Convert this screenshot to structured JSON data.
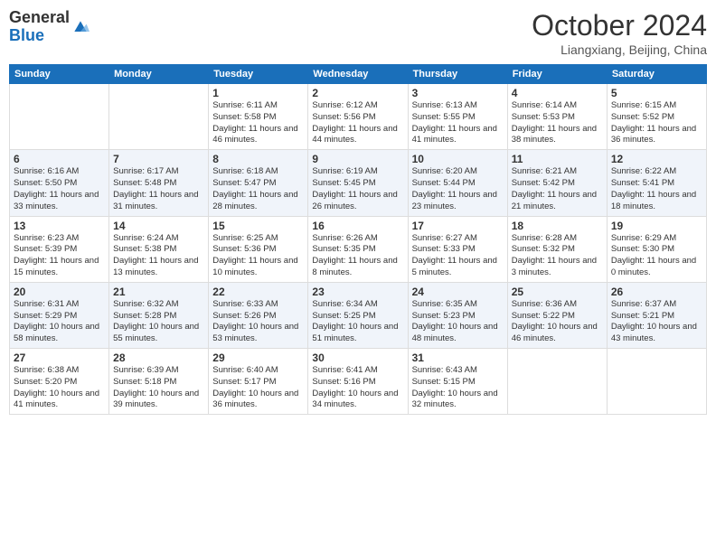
{
  "logo": {
    "line1": "General",
    "line2": "Blue"
  },
  "title": "October 2024",
  "location": "Liangxiang, Beijing, China",
  "headers": [
    "Sunday",
    "Monday",
    "Tuesday",
    "Wednesday",
    "Thursday",
    "Friday",
    "Saturday"
  ],
  "weeks": [
    [
      {
        "day": "",
        "info": ""
      },
      {
        "day": "",
        "info": ""
      },
      {
        "day": "1",
        "info": "Sunrise: 6:11 AM\nSunset: 5:58 PM\nDaylight: 11 hours and 46 minutes."
      },
      {
        "day": "2",
        "info": "Sunrise: 6:12 AM\nSunset: 5:56 PM\nDaylight: 11 hours and 44 minutes."
      },
      {
        "day": "3",
        "info": "Sunrise: 6:13 AM\nSunset: 5:55 PM\nDaylight: 11 hours and 41 minutes."
      },
      {
        "day": "4",
        "info": "Sunrise: 6:14 AM\nSunset: 5:53 PM\nDaylight: 11 hours and 38 minutes."
      },
      {
        "day": "5",
        "info": "Sunrise: 6:15 AM\nSunset: 5:52 PM\nDaylight: 11 hours and 36 minutes."
      }
    ],
    [
      {
        "day": "6",
        "info": "Sunrise: 6:16 AM\nSunset: 5:50 PM\nDaylight: 11 hours and 33 minutes."
      },
      {
        "day": "7",
        "info": "Sunrise: 6:17 AM\nSunset: 5:48 PM\nDaylight: 11 hours and 31 minutes."
      },
      {
        "day": "8",
        "info": "Sunrise: 6:18 AM\nSunset: 5:47 PM\nDaylight: 11 hours and 28 minutes."
      },
      {
        "day": "9",
        "info": "Sunrise: 6:19 AM\nSunset: 5:45 PM\nDaylight: 11 hours and 26 minutes."
      },
      {
        "day": "10",
        "info": "Sunrise: 6:20 AM\nSunset: 5:44 PM\nDaylight: 11 hours and 23 minutes."
      },
      {
        "day": "11",
        "info": "Sunrise: 6:21 AM\nSunset: 5:42 PM\nDaylight: 11 hours and 21 minutes."
      },
      {
        "day": "12",
        "info": "Sunrise: 6:22 AM\nSunset: 5:41 PM\nDaylight: 11 hours and 18 minutes."
      }
    ],
    [
      {
        "day": "13",
        "info": "Sunrise: 6:23 AM\nSunset: 5:39 PM\nDaylight: 11 hours and 15 minutes."
      },
      {
        "day": "14",
        "info": "Sunrise: 6:24 AM\nSunset: 5:38 PM\nDaylight: 11 hours and 13 minutes."
      },
      {
        "day": "15",
        "info": "Sunrise: 6:25 AM\nSunset: 5:36 PM\nDaylight: 11 hours and 10 minutes."
      },
      {
        "day": "16",
        "info": "Sunrise: 6:26 AM\nSunset: 5:35 PM\nDaylight: 11 hours and 8 minutes."
      },
      {
        "day": "17",
        "info": "Sunrise: 6:27 AM\nSunset: 5:33 PM\nDaylight: 11 hours and 5 minutes."
      },
      {
        "day": "18",
        "info": "Sunrise: 6:28 AM\nSunset: 5:32 PM\nDaylight: 11 hours and 3 minutes."
      },
      {
        "day": "19",
        "info": "Sunrise: 6:29 AM\nSunset: 5:30 PM\nDaylight: 11 hours and 0 minutes."
      }
    ],
    [
      {
        "day": "20",
        "info": "Sunrise: 6:31 AM\nSunset: 5:29 PM\nDaylight: 10 hours and 58 minutes."
      },
      {
        "day": "21",
        "info": "Sunrise: 6:32 AM\nSunset: 5:28 PM\nDaylight: 10 hours and 55 minutes."
      },
      {
        "day": "22",
        "info": "Sunrise: 6:33 AM\nSunset: 5:26 PM\nDaylight: 10 hours and 53 minutes."
      },
      {
        "day": "23",
        "info": "Sunrise: 6:34 AM\nSunset: 5:25 PM\nDaylight: 10 hours and 51 minutes."
      },
      {
        "day": "24",
        "info": "Sunrise: 6:35 AM\nSunset: 5:23 PM\nDaylight: 10 hours and 48 minutes."
      },
      {
        "day": "25",
        "info": "Sunrise: 6:36 AM\nSunset: 5:22 PM\nDaylight: 10 hours and 46 minutes."
      },
      {
        "day": "26",
        "info": "Sunrise: 6:37 AM\nSunset: 5:21 PM\nDaylight: 10 hours and 43 minutes."
      }
    ],
    [
      {
        "day": "27",
        "info": "Sunrise: 6:38 AM\nSunset: 5:20 PM\nDaylight: 10 hours and 41 minutes."
      },
      {
        "day": "28",
        "info": "Sunrise: 6:39 AM\nSunset: 5:18 PM\nDaylight: 10 hours and 39 minutes."
      },
      {
        "day": "29",
        "info": "Sunrise: 6:40 AM\nSunset: 5:17 PM\nDaylight: 10 hours and 36 minutes."
      },
      {
        "day": "30",
        "info": "Sunrise: 6:41 AM\nSunset: 5:16 PM\nDaylight: 10 hours and 34 minutes."
      },
      {
        "day": "31",
        "info": "Sunrise: 6:43 AM\nSunset: 5:15 PM\nDaylight: 10 hours and 32 minutes."
      },
      {
        "day": "",
        "info": ""
      },
      {
        "day": "",
        "info": ""
      }
    ]
  ]
}
